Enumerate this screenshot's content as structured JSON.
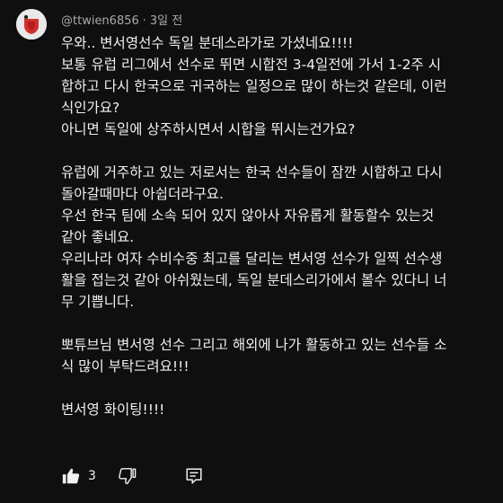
{
  "comment": {
    "author": "@ttwien6856",
    "time_ago": "3일 전",
    "separator": "·",
    "lines": [
      "우와.. 변서영선수 독일 분데스라가로 가셨네요!!!!",
      "보통 유럽 리그에서 선수로 뛰면 시합전 3-4일전에 가서 1-2주 시",
      "합하고 다시 한국으로 귀국하는 일정으로 많이 하는것 같은데, 이런",
      "식인가요?",
      "아니면 독일에 상주하시면서 시합을 뛰시는건가요?",
      "",
      "유럽에 거주하고 있는 저로서는 한국 선수들이 잠깐 시합하고 다시",
      "돌아갈때마다 아쉽더라구요.",
      "우선 한국 팀에 소속 되어 있지 않아사 자유롭게 활동할수 있는것",
      "같아 좋네요.",
      "우리나라 여자 수비수중 최고를 달리는 변서영 선수가 일찍 선수생",
      "활을 접는것 같아 아쉬웠는데, 독일 분데스리가에서 볼수 있다니 너",
      "무 기쁩니다.",
      "",
      "뽀튜브님 변서영 선수 그리고 해외에 나가 활동하고 있는 선수들 소",
      "식 많이 부탁드려요!!!",
      "",
      "변서영 화이팅!!!!"
    ],
    "like_count": "3"
  },
  "icons": {
    "like": "thumbs-up-icon",
    "dislike": "thumbs-down-icon",
    "reply": "reply-comment-icon",
    "avatar": "avatar-logo"
  },
  "colors": {
    "background": "#0f0f0f",
    "text": "#f1f1f1",
    "meta_text": "#aaaaaa",
    "avatar_bg": "#e9e9e9",
    "avatar_accent": "#d32f2f"
  }
}
